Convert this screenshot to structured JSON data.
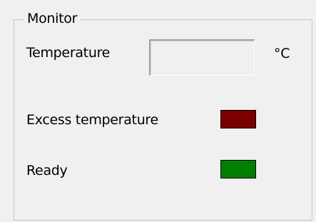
{
  "groupbox": {
    "title": "Monitor"
  },
  "temperature": {
    "label": "Temperature",
    "value": "",
    "unit": "°C"
  },
  "excess_temperature": {
    "label": "Excess temperature",
    "color": "#7a0000"
  },
  "ready": {
    "label": "Ready",
    "color": "#008000"
  }
}
